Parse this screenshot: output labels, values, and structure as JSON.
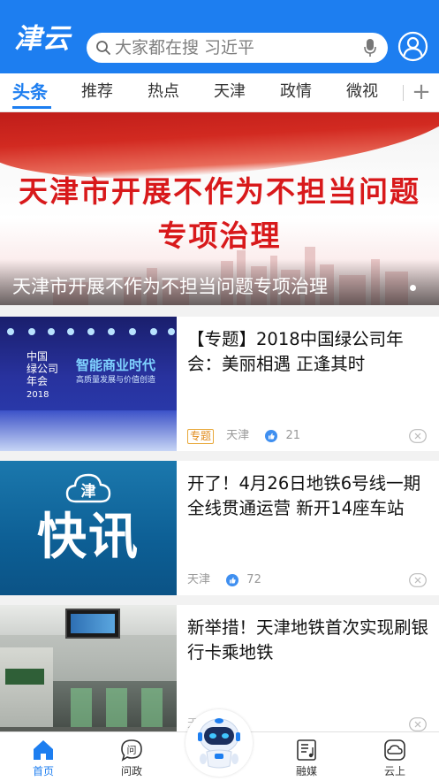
{
  "header": {
    "logo_text": "津云",
    "search_placeholder": "大家都在搜 习近平"
  },
  "tabs": [
    {
      "label": "头条",
      "active": true
    },
    {
      "label": "推荐"
    },
    {
      "label": "热点"
    },
    {
      "label": "天津"
    },
    {
      "label": "政情"
    },
    {
      "label": "微视"
    }
  ],
  "banner": {
    "headline_line1": "天津市开展不作为不担当问题",
    "headline_line2": "专项治理",
    "caption": "天津市开展不作为不担当问题专项治理"
  },
  "news": [
    {
      "title": "【专题】2018中国绿公司年会：美丽相遇 正逢其时",
      "tag": "专题",
      "source": "天津",
      "likes": "21",
      "thumb": {
        "logo": "中国\n绿公司\n年会",
        "year": "2018",
        "headline": "智能商业时代",
        "subhead": "高质量发展与价值创造"
      }
    },
    {
      "title": "开了！4月26日地铁6号线一期全线贯通运营 新开14座车站",
      "source": "天津",
      "likes": "72",
      "thumb": {
        "logo": "津",
        "headline": "快讯"
      }
    },
    {
      "title": "新举措！天津地铁首次实现刷银行卡乘地铁",
      "source": "天"
    }
  ],
  "bottom_nav": [
    {
      "label": "首页",
      "icon": "home-icon",
      "active": true
    },
    {
      "label": "问政",
      "icon": "wenzheng-icon"
    },
    {
      "label": "融媒",
      "icon": "rongmei-icon"
    },
    {
      "label": "云上",
      "icon": "cloud-icon"
    }
  ],
  "colors": {
    "brand_blue": "#1d7ef0",
    "headline_red": "#d8191b",
    "tag_orange": "#e08b1b"
  }
}
